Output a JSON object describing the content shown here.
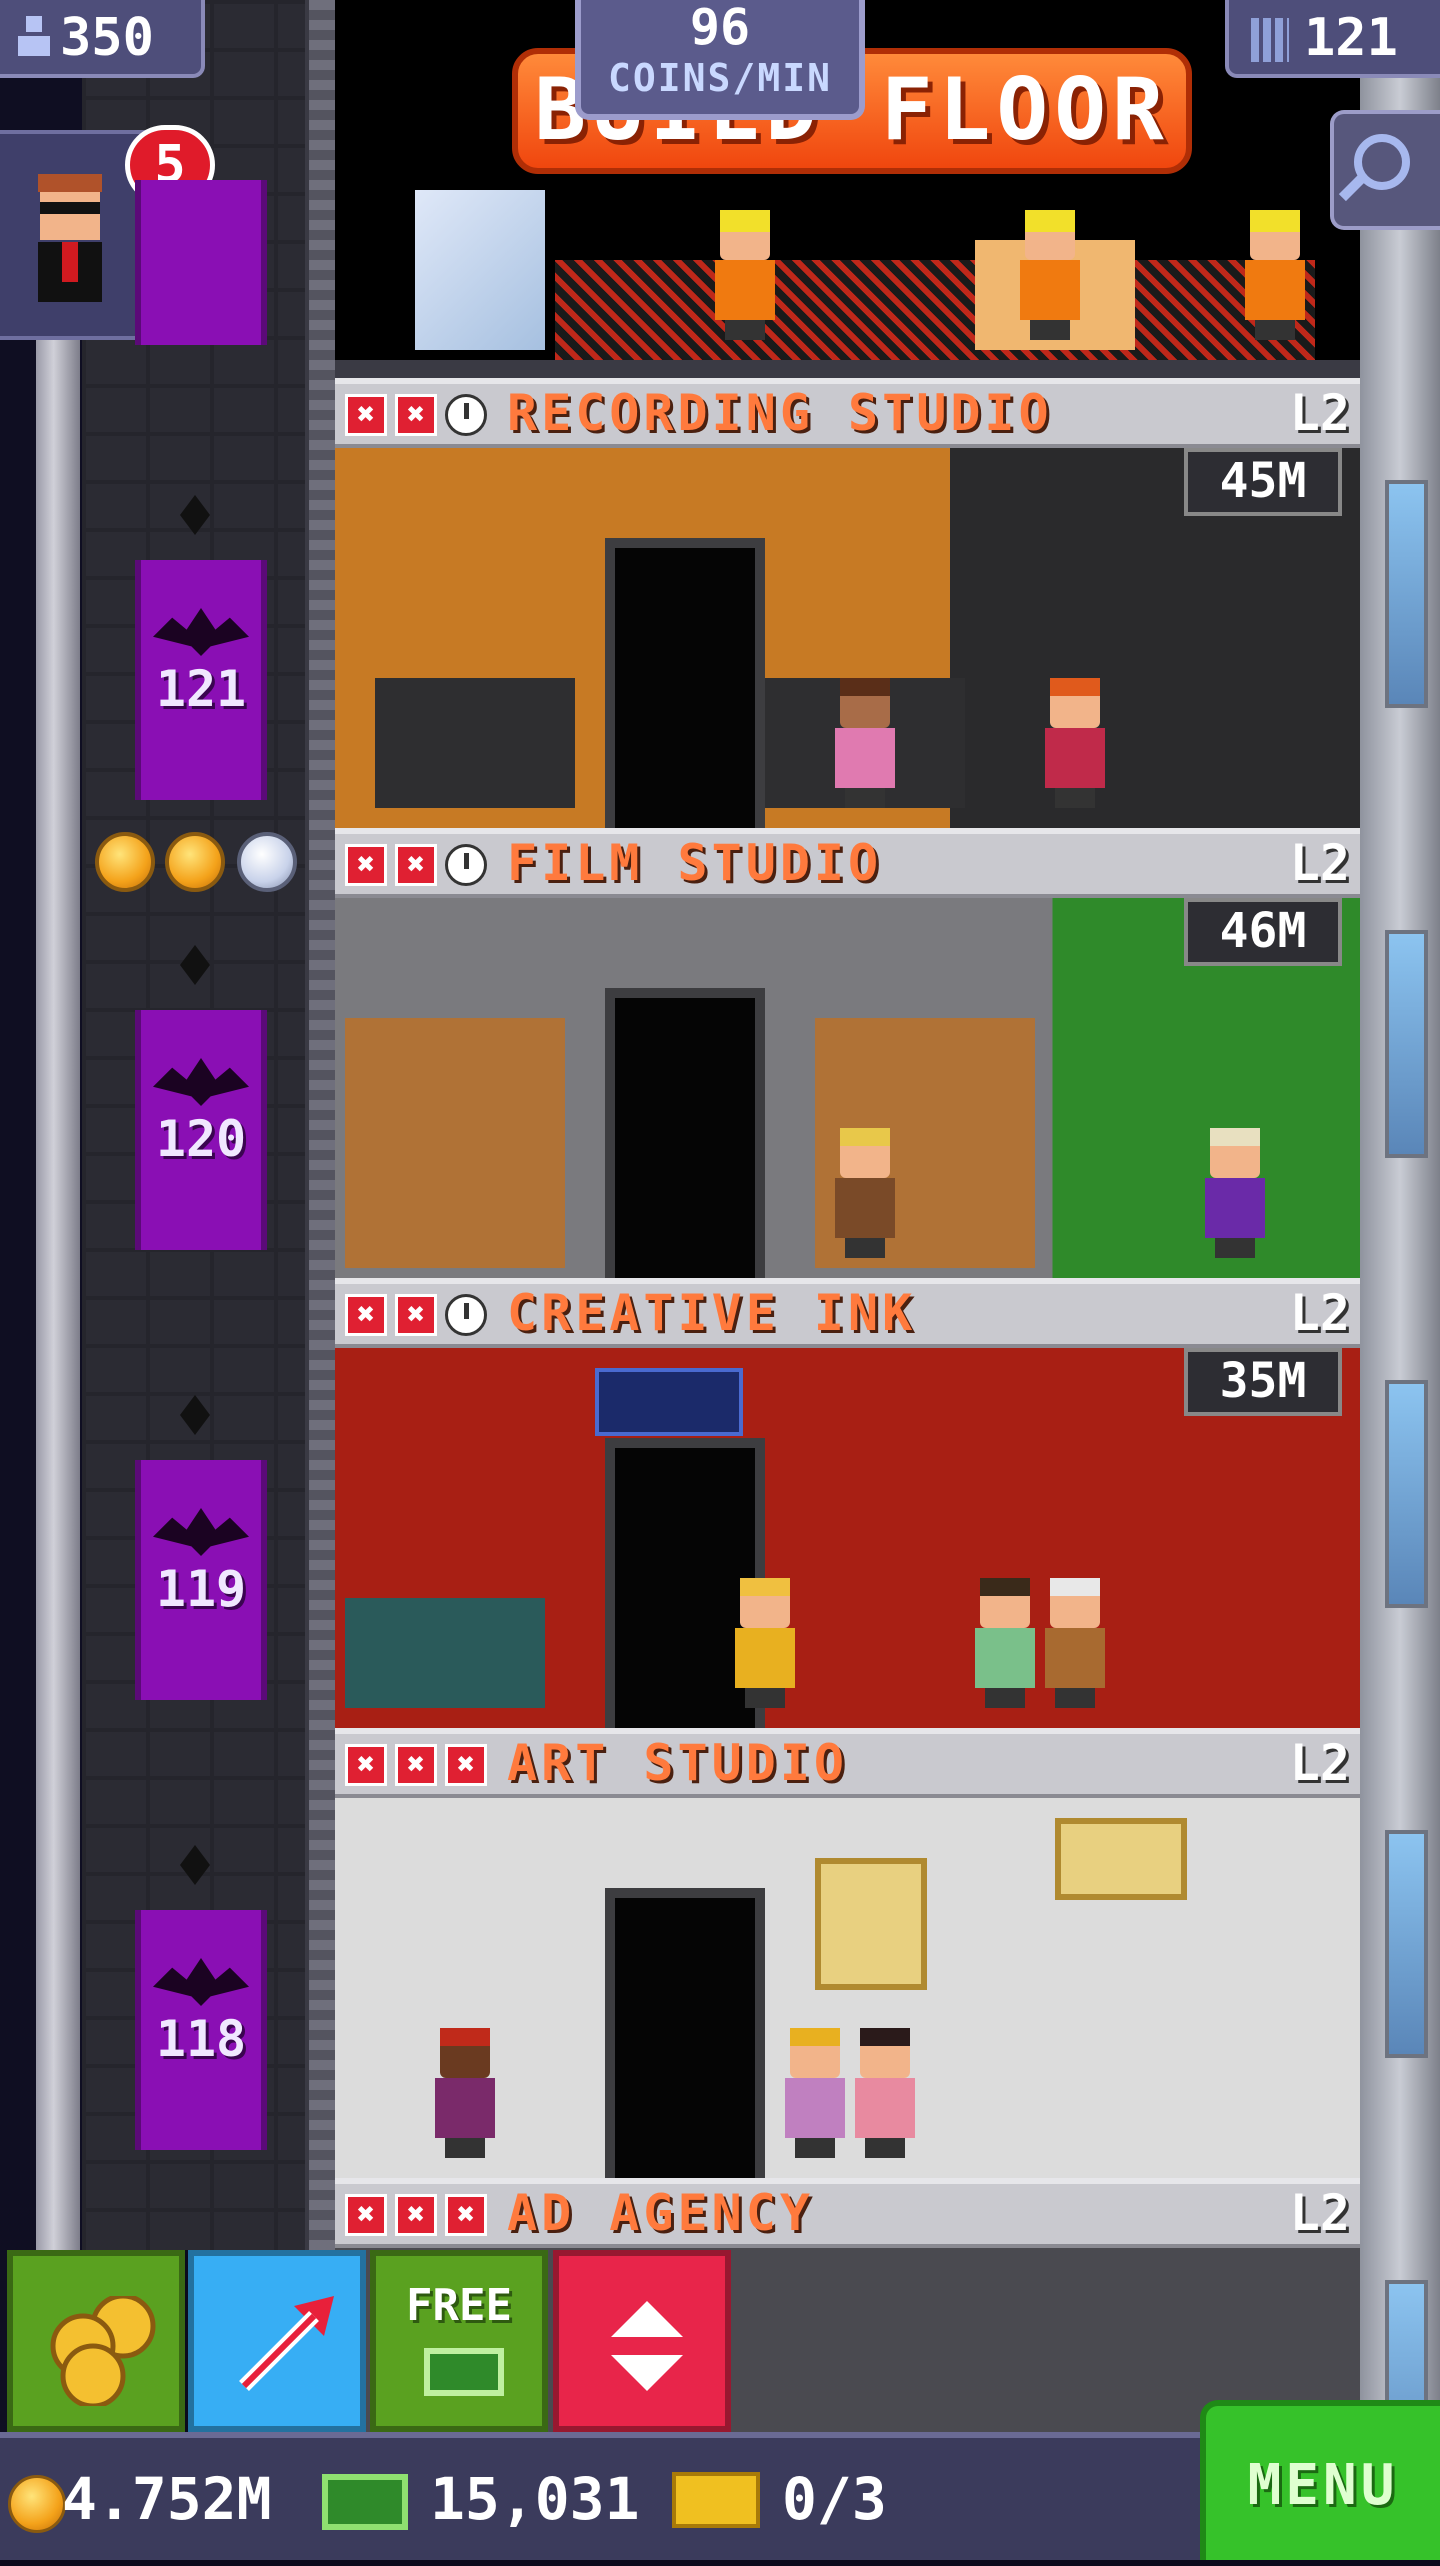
{
  "hud": {
    "population": "350",
    "coins_per_min_value": "96",
    "coins_per_min_label": "COINS/MIN",
    "floors_count": "121",
    "vip_badge_count": "5",
    "build_button_label": "BUILD FLOOR"
  },
  "floors": [
    {
      "name": "RECORDING STUDIO",
      "level": "L2",
      "timer": "45M",
      "elevator_number": "121",
      "status": [
        "x",
        "x",
        "clock"
      ]
    },
    {
      "name": "FILM STUDIO",
      "level": "L2",
      "timer": "46M",
      "elevator_number": "120",
      "status": [
        "x",
        "x",
        "clock"
      ]
    },
    {
      "name": "CREATIVE INK",
      "level": "L2",
      "timer": "35M",
      "elevator_number": "119",
      "status": [
        "x",
        "x",
        "clock"
      ]
    },
    {
      "name": "ART STUDIO",
      "level": "L2",
      "timer": "",
      "elevator_number": "118",
      "status": [
        "x",
        "x",
        "x"
      ]
    },
    {
      "name": "AD AGENCY",
      "level": "L2",
      "timer": "",
      "elevator_number": "",
      "status": [
        "x",
        "x",
        "x"
      ]
    }
  ],
  "toolbar": {
    "free_label": "FREE",
    "menu_label": "MENU"
  },
  "currency": {
    "coins": "4.752M",
    "bux": "15,031",
    "tickets": "0/3"
  },
  "colors": {
    "build_button": "#f0460e",
    "elevator": "#8a0fb4",
    "menu": "#36c22a",
    "floor_name": "#ff7a3d"
  }
}
